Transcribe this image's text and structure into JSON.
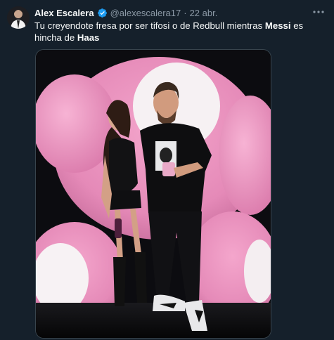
{
  "tweet": {
    "author_name": "Alex Escalera",
    "handle": "@alexescalera17",
    "separator": "·",
    "date": "22 abr.",
    "text_parts": {
      "p1": "Tu creyendote fresa por ser tifosi o de Redbull mientras ",
      "bold1": "Messi",
      "p2": " es hincha de ",
      "bold2": "Haas"
    }
  },
  "icons": {
    "verified": "verified-badge-icon",
    "more": "more-options-icon"
  },
  "colors": {
    "background": "#15202b",
    "text": "#f7f9f9",
    "secondary_text": "#8b98a5",
    "verified": "#1d9bf0",
    "pink_bear": "#e98fbd"
  }
}
